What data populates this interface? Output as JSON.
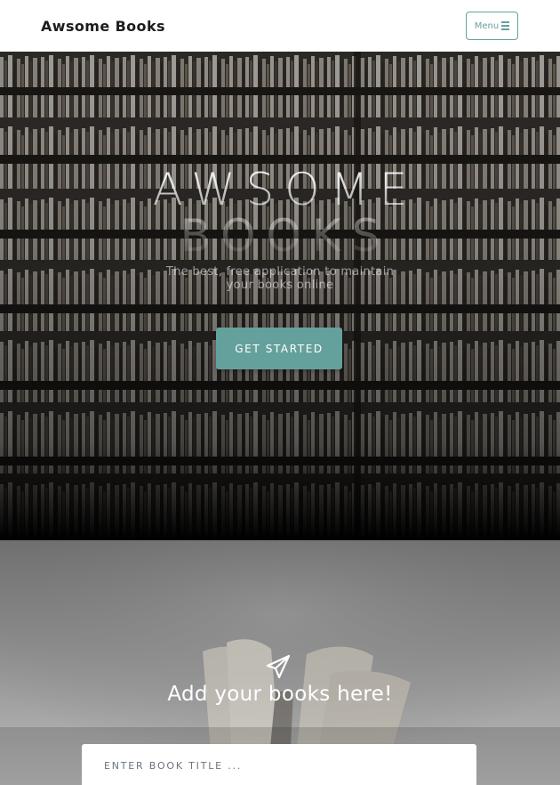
{
  "navbar": {
    "brand": "Awsome Books",
    "menu_label": "Menu",
    "menu_icon": "bars-icon"
  },
  "hero": {
    "title_line1": "AWSOME",
    "title_line2": "BOOKS",
    "subtitle": "The best, free application to maintain your books online",
    "cta_label": "GET STARTED"
  },
  "add_section": {
    "icon": "paper-plane-icon",
    "title": "Add your books here!",
    "title_input_placeholder": "ENTER BOOK TITLE ..."
  },
  "colors": {
    "accent": "#64a19d",
    "navbar_bg": "#ffffff",
    "brand_text": "#1d1d1d"
  }
}
